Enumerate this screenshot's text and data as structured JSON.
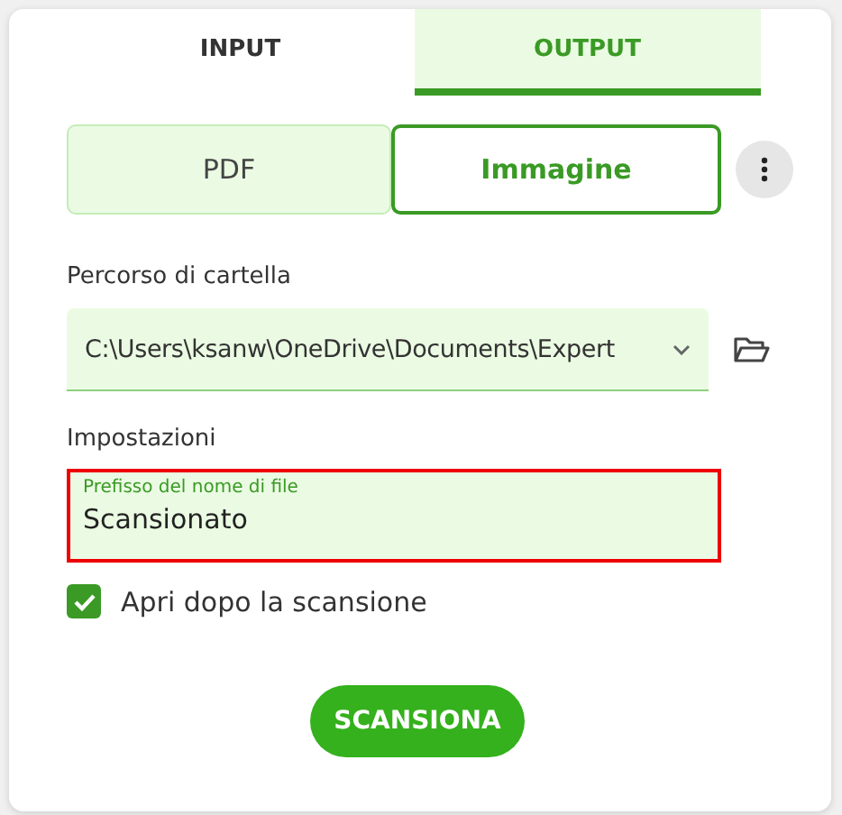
{
  "tabs": [
    {
      "label": "INPUT",
      "selected": false
    },
    {
      "label": "OUTPUT",
      "selected": true
    }
  ],
  "formats": [
    {
      "label": "PDF",
      "selected": false
    },
    {
      "label": "Immagine",
      "selected": true
    }
  ],
  "folder": {
    "label": "Percorso di cartella",
    "value": "C:\\Users\\ksanw\\OneDrive\\Documents\\Expert"
  },
  "settings": {
    "label": "Impostazioni",
    "field": {
      "label": "Prefisso del nome di file",
      "value": "Scansionato",
      "highlighted": true
    },
    "open_after": {
      "label": "Apri dopo la scansione",
      "checked": true
    }
  },
  "scan_button": "SCANSIONA"
}
